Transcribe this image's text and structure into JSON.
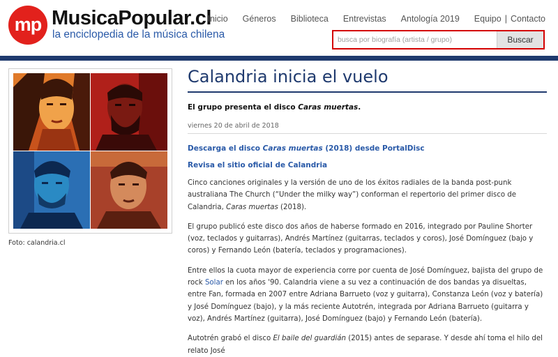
{
  "header": {
    "logo_mark": "mp",
    "site_name": "MusicaPopular.cl",
    "tagline": "la enciclopedia de la música chilena",
    "nav": [
      "Inicio",
      "Géneros",
      "Biblioteca",
      "Entrevistas",
      "Antología 2019",
      "Equipo",
      "Contacto"
    ],
    "nav_separator": "|",
    "search": {
      "placeholder": "busca por biografía (artista / grupo)",
      "button": "Buscar"
    }
  },
  "colors": {
    "brand_red": "#e2211c",
    "navy": "#1f3a6e",
    "link_blue": "#2a5aa8",
    "search_border": "#d40000"
  },
  "image": {
    "caption": "Foto: calandria.cl"
  },
  "article": {
    "title": "Calandria inicia el vuelo",
    "subtitle_prefix": "El grupo presenta el disco ",
    "subtitle_album": "Caras muertas",
    "subtitle_suffix": ".",
    "date": "viernes 20 de abril de 2018",
    "link1_prefix": "Descarga el disco ",
    "link1_album": "Caras muertas",
    "link1_suffix": " (2018) desde PortalDisc",
    "link2": "Revisa el sitio oficial de Calandria",
    "p1_text": "Cinco canciones originales y la versión de uno de los éxitos radiales de la banda post-punk australiana The Church (“Under the milky way”) conforman el repertorio del primer disco de Calandria, ",
    "p1_album": "Caras muertas",
    "p1_end": " (2018).",
    "p2": "El grupo publicó este disco dos años de haberse formado en 2016, integrado por Pauline Shorter (voz, teclados y guitarras), Andrés Martínez (guitarras, teclados y coros), José Domínguez (bajo y coros) y Fernando León (batería, teclados y programaciones).",
    "p3_a": "Entre ellos la cuota mayor de experiencia corre por cuenta de José Domínguez, bajista del grupo de rock ",
    "p3_link": "Solar",
    "p3_b": " en los años '90. Calandria viene a su vez a continuación de dos bandas ya disueltas, entre Fan, formada en 2007 entre Adriana Barrueto (voz y guitarra), Constanza León (voz y batería) y José Domínguez (bajo), y la más reciente Autotrén, integrada por Adriana Barrueto (guitarra y voz), Andrés Martínez (guitarra), José Domínguez (bajo) y Fernando León (batería).",
    "p4_a": "Autotrén grabó el disco ",
    "p4_album": "El baile del guardián",
    "p4_b": " (2015) antes de separase. Y desde ahí toma el hilo del relato José"
  }
}
